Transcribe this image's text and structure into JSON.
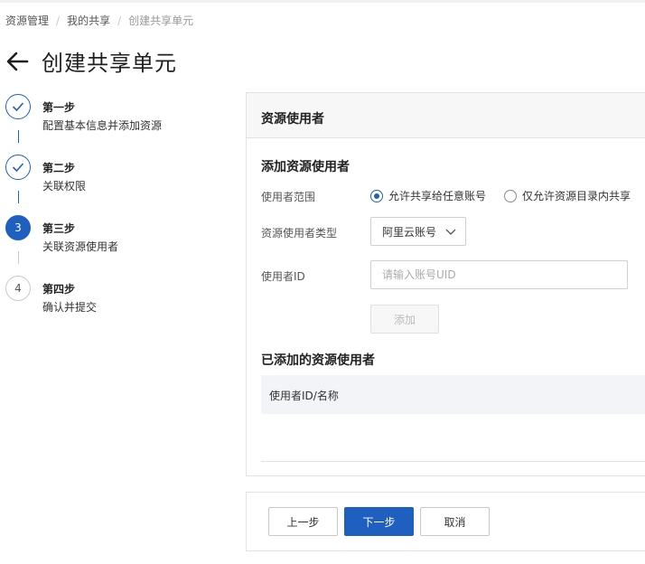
{
  "breadcrumb": {
    "items": [
      "资源管理",
      "我的共享",
      "创建共享单元"
    ]
  },
  "page": {
    "title": "创建共享单元"
  },
  "steps": [
    {
      "title": "第一步",
      "desc": "配置基本信息并添加资源",
      "state": "done",
      "marker": ""
    },
    {
      "title": "第二步",
      "desc": "关联权限",
      "state": "done",
      "marker": ""
    },
    {
      "title": "第三步",
      "desc": "关联资源使用者",
      "state": "active",
      "marker": "3"
    },
    {
      "title": "第四步",
      "desc": "确认并提交",
      "state": "todo",
      "marker": "4"
    }
  ],
  "panel": {
    "header": "资源使用者",
    "add_section_title": "添加资源使用者",
    "scope_label": "使用者范围",
    "scope_options": [
      "允许共享给任意账号",
      "仅允许资源目录内共享"
    ],
    "scope_selected": 0,
    "type_label": "资源使用者类型",
    "type_value": "阿里云账号",
    "id_label": "使用者ID",
    "id_placeholder": "请输入账号UID",
    "id_value": "",
    "add_button": "添加",
    "added_section_title": "已添加的资源使用者",
    "table_columns": [
      "使用者ID/名称"
    ],
    "table_rows": []
  },
  "footer": {
    "prev_label": "上一步",
    "next_label": "下一步",
    "cancel_label": "取消"
  },
  "colors": {
    "primary": "#1f5fbf",
    "border": "#e3e3e3",
    "header_bg": "#f7f7f7"
  }
}
